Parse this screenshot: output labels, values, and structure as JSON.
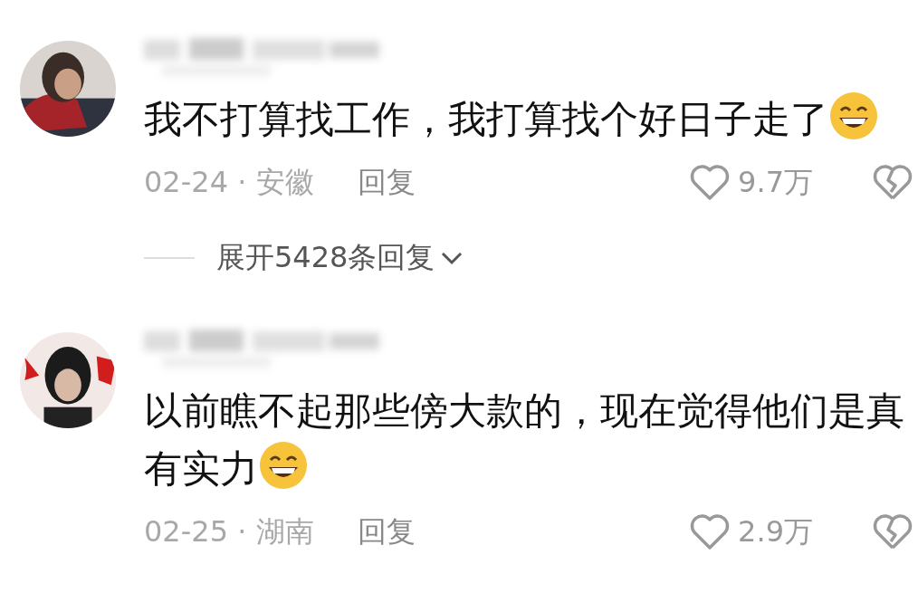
{
  "comments": [
    {
      "avatar": {
        "kind": "picture"
      },
      "lines": [
        "我不打算找工作，我打算找个好日子走了"
      ],
      "meta": "02-24 · 安徽",
      "reply": "回复",
      "likes": "9.7万",
      "expand": "展开5428条回复"
    },
    {
      "avatar": {
        "kind": "picture"
      },
      "lines": [
        "以前瞧不起那些傍大款的，现在觉得他们是真",
        "有实力"
      ],
      "meta": "02-25 · 湖南",
      "reply": "回复",
      "likes": "2.9万"
    }
  ]
}
